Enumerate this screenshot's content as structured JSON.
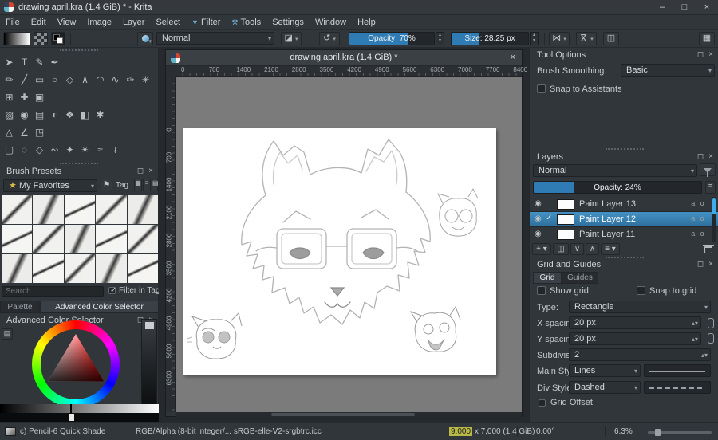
{
  "colors": {
    "accent": "#3daee9",
    "selection": "#3577a1"
  },
  "title_bar": {
    "title": "drawing april.kra (1.4 GiB) * - Krita",
    "minimize_glyph": "–",
    "maximize_glyph": "□",
    "close_glyph": "×"
  },
  "menu": {
    "items": [
      "File",
      "Edit",
      "View",
      "Image",
      "Layer",
      "Select",
      "Filter",
      "Tools",
      "Settings",
      "Window",
      "Help"
    ]
  },
  "toolbar": {
    "blending_mode": "Normal",
    "opacity_label": "Opacity: 70%",
    "opacity_percent": 70,
    "size_label": "Size: 28.25 px",
    "size_percent": 36
  },
  "toolbox": {
    "rows": [
      [
        {
          "name": "select-shapes-tool",
          "glyph": "➤"
        },
        {
          "name": "text-tool",
          "glyph": "T"
        },
        {
          "name": "edit-shapes-tool",
          "glyph": "✎"
        },
        {
          "name": "calligraphy-tool",
          "glyph": "✒"
        }
      ],
      [
        {
          "name": "freehand-brush-tool",
          "glyph": "✏"
        },
        {
          "name": "line-tool",
          "glyph": "╱"
        },
        {
          "name": "rectangle-tool",
          "glyph": "▭"
        },
        {
          "name": "ellipse-tool",
          "glyph": "○"
        },
        {
          "name": "polygon-tool",
          "glyph": "◇"
        },
        {
          "name": "polyline-tool",
          "glyph": "∧"
        },
        {
          "name": "bezier-curve-tool",
          "glyph": "◠"
        },
        {
          "name": "freehand-path-tool",
          "glyph": "∿"
        },
        {
          "name": "dynamic-brush-tool",
          "glyph": "✑"
        },
        {
          "name": "multibrush-tool",
          "glyph": "✳"
        }
      ],
      [
        {
          "name": "transform-tool",
          "glyph": "⊞"
        },
        {
          "name": "move-tool",
          "glyph": "✚"
        },
        {
          "name": "crop-tool",
          "glyph": "▣"
        }
      ],
      [
        {
          "name": "gradient-tool",
          "glyph": "▨"
        },
        {
          "name": "color-sampler-tool",
          "glyph": "◉"
        },
        {
          "name": "pattern-edit-tool",
          "glyph": "▤"
        },
        {
          "name": "colorize-mask-tool",
          "glyph": "◐"
        },
        {
          "name": "smart-patch-tool",
          "glyph": "❖"
        },
        {
          "name": "fill-tool",
          "glyph": "◧"
        },
        {
          "name": "enclose-fill-tool",
          "glyph": "✱"
        }
      ],
      [
        {
          "name": "assistants-tool",
          "glyph": "△"
        },
        {
          "name": "measure-tool",
          "glyph": "∠"
        },
        {
          "name": "reference-images-tool",
          "glyph": "◳"
        }
      ],
      [
        {
          "name": "rect-select-tool",
          "glyph": "▢"
        },
        {
          "name": "ellipse-select-tool",
          "glyph": "◌"
        },
        {
          "name": "polygon-select-tool",
          "glyph": "◇"
        },
        {
          "name": "freehand-select-tool",
          "glyph": "∾"
        },
        {
          "name": "similar-color-select-tool",
          "glyph": "✦"
        },
        {
          "name": "contiguous-select-tool",
          "glyph": "✴"
        },
        {
          "name": "bezier-select-tool",
          "glyph": "≈"
        },
        {
          "name": "magnetic-select-tool",
          "glyph": "≀"
        }
      ]
    ]
  },
  "brush_docker": {
    "title": "Brush Presets",
    "favorites_label": "My Favorites",
    "tag_label": "Tag",
    "search_placeholder": "Search",
    "filter_in_tag_label": "Filter in Tag",
    "preset_count": 15
  },
  "left_tabs": {
    "palette": "Palette",
    "advanced": "Advanced Color Selector"
  },
  "color_docker": {
    "title": "Advanced Color Selector"
  },
  "canvas": {
    "tab_title": "drawing april.kra (1.4 GiB) *",
    "h_ruler": [
      "0",
      "700",
      "1400",
      "2100",
      "2800",
      "3500",
      "4200",
      "4900",
      "5600",
      "6300",
      "7000",
      "7700",
      "8400"
    ],
    "v_ruler": [
      "0",
      "700",
      "1400",
      "2100",
      "2800",
      "3500",
      "4200",
      "4900",
      "5600",
      "6300"
    ]
  },
  "tool_options": {
    "title": "Tool Options",
    "brush_smoothing_label": "Brush Smoothing:",
    "brush_smoothing_value": "Basic",
    "snap_to_assistants_label": "Snap to Assistants"
  },
  "layers": {
    "title": "Layers",
    "blending_mode": "Normal",
    "opacity_label": "Opacity:  24%",
    "opacity_percent": 24,
    "items": [
      {
        "name": "Paint Layer 13",
        "selected": false
      },
      {
        "name": "Paint Layer 12",
        "selected": true
      },
      {
        "name": "Paint Layer 11",
        "selected": false
      }
    ]
  },
  "grid_guides": {
    "title": "Grid and Guides",
    "tab_grid": "Grid",
    "tab_guides": "Guides",
    "show_grid_label": "Show grid",
    "snap_to_grid_label": "Snap to grid",
    "type_label": "Type:",
    "type_value": "Rectangle",
    "x_spacing_label": "X spacing:",
    "x_spacing_value": "20 px",
    "y_spacing_label": "Y spacing:",
    "y_spacing_value": "20 px",
    "subdivision_label": "Subdivision:",
    "subdivision_value": "2",
    "main_style_label": "Main Style:",
    "main_style_value": "Lines",
    "div_style_label": "Div Style:",
    "div_style_value": "Dashed",
    "grid_offset_label": "Grid Offset"
  },
  "status_bar": {
    "brush_name": "c) Pencil-6 Quick Shade",
    "color_profile": "RGB/Alpha (8-bit integer/...  sRGB-elle-V2-srgbtrc.icc",
    "memory_value": "9,000",
    "dimensions": "x 7,000 (1.4 GiB)",
    "angle": "0.00°",
    "zoom": "6.3%"
  }
}
